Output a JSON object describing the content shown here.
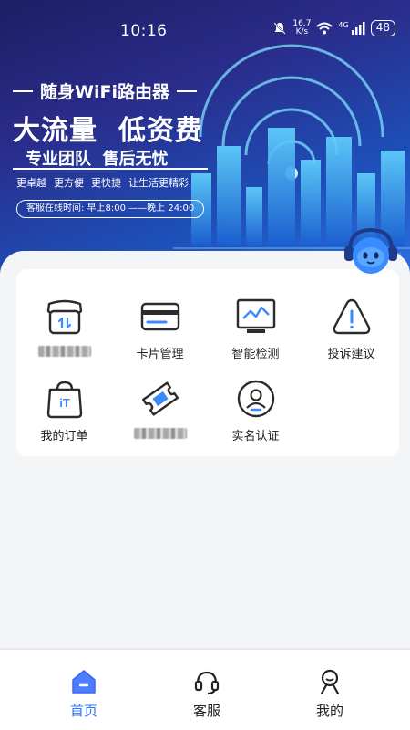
{
  "status_bar": {
    "time": "10:16",
    "speed_value": "16.7",
    "speed_unit": "K/s",
    "network": "4G",
    "battery": "48"
  },
  "hero": {
    "subtitle": "随身WiFi路由器",
    "title": "大流量  低资费",
    "tagline": "专业团队  售后无忧",
    "features": [
      "更卓越",
      "更方便",
      "更快捷",
      "让生活更精彩"
    ],
    "service_hours": "客服在线时间: 早上8:00 ——晚上 24:00"
  },
  "menu": {
    "items": [
      {
        "label": "",
        "icon": "shop-icon",
        "obscured": true
      },
      {
        "label": "卡片管理",
        "icon": "card-icon"
      },
      {
        "label": "智能检测",
        "icon": "monitor-icon"
      },
      {
        "label": "投诉建议",
        "icon": "warning-icon"
      },
      {
        "label": "我的订单",
        "icon": "bag-icon"
      },
      {
        "label": "",
        "icon": "ticket-icon",
        "obscured": true
      },
      {
        "label": "实名认证",
        "icon": "user-circle-icon"
      }
    ]
  },
  "nav": {
    "items": [
      {
        "label": "首页",
        "icon": "home-icon",
        "active": true
      },
      {
        "label": "客服",
        "icon": "headset-icon"
      },
      {
        "label": "我的",
        "icon": "profile-icon"
      }
    ]
  },
  "colors": {
    "accent": "#2f74ff",
    "hero_dark": "#1b1f63",
    "hero_light": "#2d6ee0",
    "icon_stroke": "#2b2b2b",
    "icon_accent": "#3a8bff"
  }
}
